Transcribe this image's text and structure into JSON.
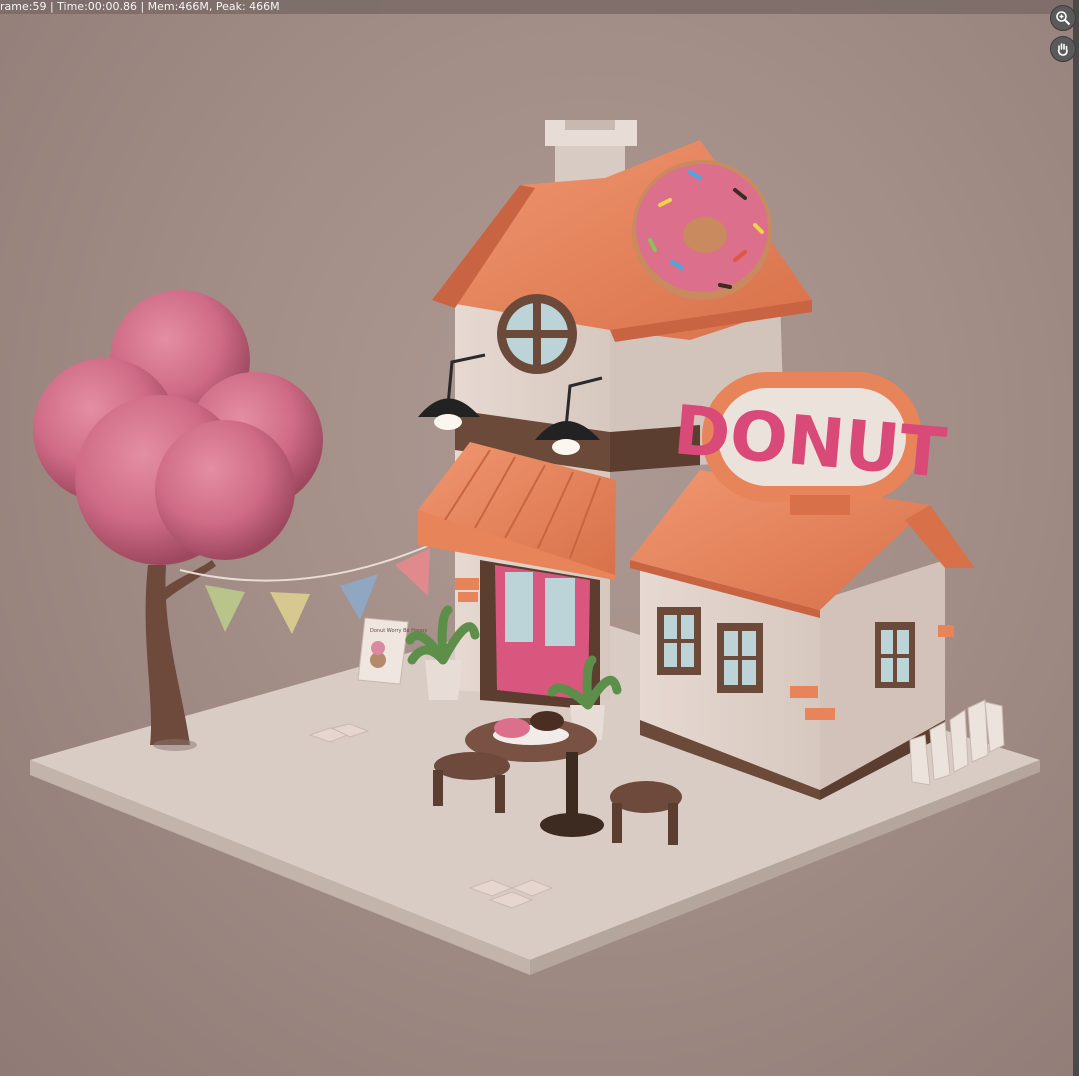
{
  "status": {
    "text": "rame:59 | Time:00:00.86 | Mem:466M, Peak: 466M"
  },
  "navigation": {
    "zoom_icon": "zoom-magnifier-icon",
    "pan_icon": "pan-hand-icon"
  },
  "scene": {
    "sign_text": "DONUT",
    "poster_text": "Donut Worry Be Happy"
  },
  "colors": {
    "roof": "#e8845a",
    "walls": "#e8ddd6",
    "trim": "#6b4a3a",
    "sign_text": "#d94a78",
    "donut_icing": "#dc6f8c",
    "tree": "#cf6b86",
    "ground": "#d8cbc4"
  }
}
